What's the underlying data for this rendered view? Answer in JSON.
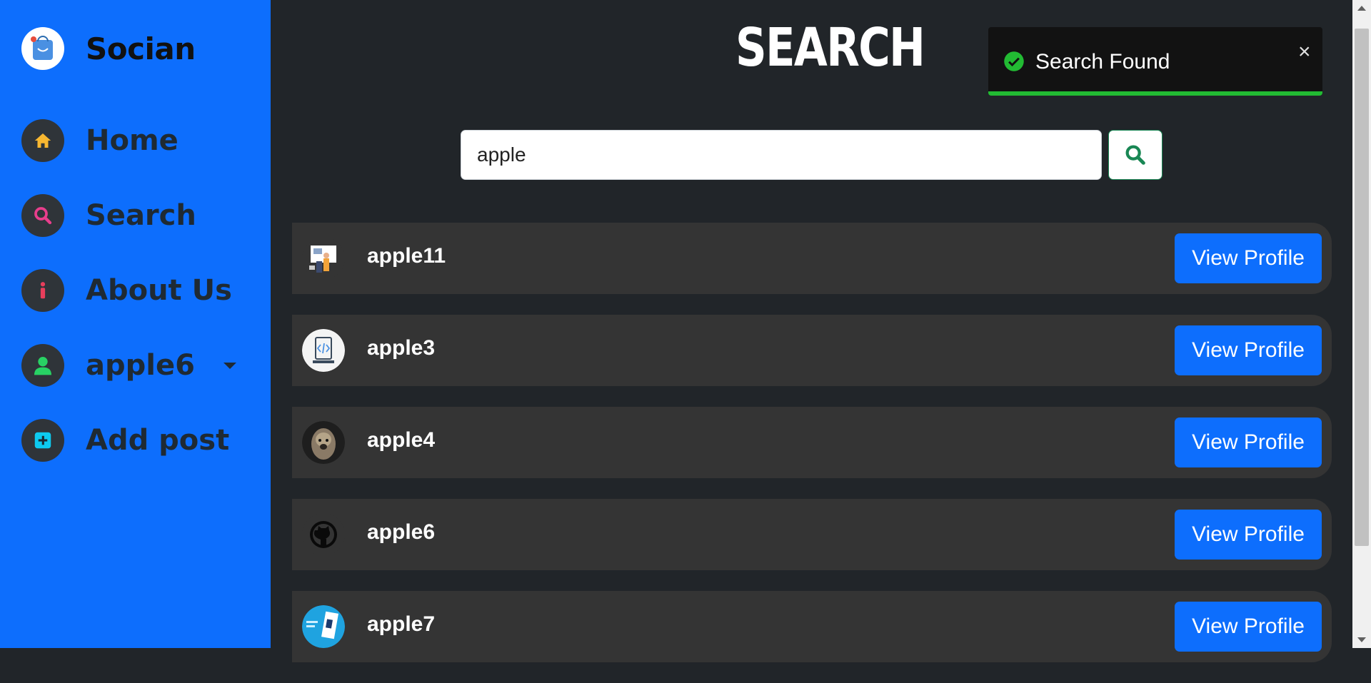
{
  "brand": {
    "name": "Socian",
    "logo_icon": "shopping-bag-icon"
  },
  "nav": {
    "items": [
      {
        "label": "Home",
        "icon": "home-icon",
        "icon_color": "#f7b731"
      },
      {
        "label": "Search",
        "icon": "search-icon",
        "icon_color": "#e83e8c"
      },
      {
        "label": "About Us",
        "icon": "info-icon",
        "icon_color": "#e83e5c"
      },
      {
        "label": "apple6",
        "icon": "user-icon",
        "icon_color": "#28d264",
        "has_dropdown": true
      },
      {
        "label": "Add post",
        "icon": "plus-square-icon",
        "icon_color": "#0dcaf0"
      }
    ]
  },
  "main": {
    "title": "SEARCH",
    "search": {
      "value": "apple",
      "button_icon": "search-icon"
    }
  },
  "results": [
    {
      "username": "apple11",
      "button_label": "View Profile",
      "avatar": "illustration-avatar"
    },
    {
      "username": "apple3",
      "button_label": "View Profile",
      "avatar": "code-device-avatar"
    },
    {
      "username": "apple4",
      "button_label": "View Profile",
      "avatar": "dog-photo-avatar"
    },
    {
      "username": "apple6",
      "button_label": "View Profile",
      "avatar": "github-avatar"
    },
    {
      "username": "apple7",
      "button_label": "View Profile",
      "avatar": "blue-graphic-avatar"
    }
  ],
  "toast": {
    "message": "Search Found",
    "icon": "check-circle-icon",
    "close_label": "×",
    "progress": 1.0,
    "accent": "#22bb33"
  },
  "colors": {
    "sidebar": "#0d6efd",
    "background": "#212529",
    "row": "#343434",
    "button": "#0d6efd"
  }
}
